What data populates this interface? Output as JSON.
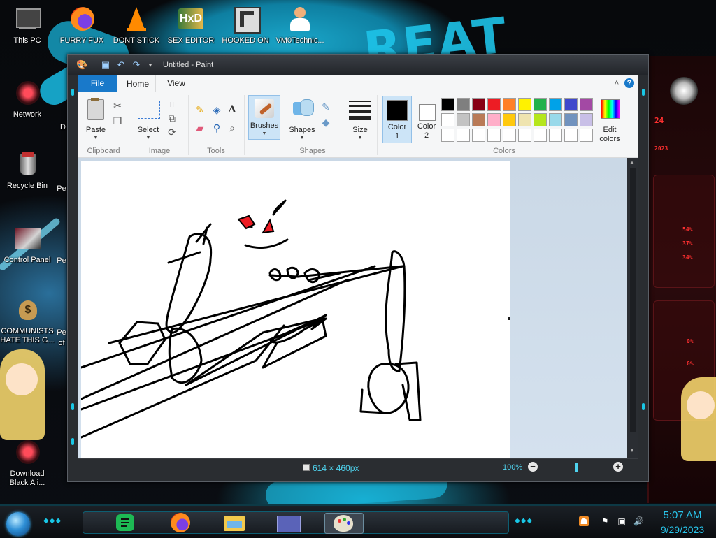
{
  "desktop": {
    "icons": [
      {
        "label": "This PC"
      },
      {
        "label": "FURRY FUX"
      },
      {
        "label": "DONT STICK"
      },
      {
        "label": "SEX EDITOR"
      },
      {
        "label": "HOOKED ON"
      },
      {
        "label": "VM0Technic..."
      },
      {
        "label": "Network"
      },
      {
        "label": "Recycle Bin"
      },
      {
        "label": "Control Panel"
      },
      {
        "label": "COMMUNISTS HATE THIS G..."
      },
      {
        "label": "Download Black Ali..."
      }
    ],
    "partial_labels": [
      "Pe",
      "Pe",
      "Pe",
      "Pe",
      "of",
      "D",
      "o"
    ]
  },
  "gadget": {
    "top_text": "24",
    "sub_text": "2023",
    "readouts": [
      "54%",
      "37%",
      "34%",
      "0%",
      "0%"
    ]
  },
  "paint": {
    "title": "Untitled - Paint",
    "tabs": {
      "file": "File",
      "home": "Home",
      "view": "View"
    },
    "groups": {
      "clipboard": "Clipboard",
      "image": "Image",
      "tools": "Tools",
      "shapes": "Shapes",
      "colors": "Colors"
    },
    "buttons": {
      "paste": "Paste",
      "select": "Select",
      "brushes": "Brushes",
      "shapes": "Shapes",
      "size": "Size",
      "color1": "Color",
      "color1_num": "1",
      "color2": "Color",
      "color2_num": "2",
      "edit_colors": "Edit",
      "edit_colors_2": "colors"
    },
    "text_tool": "A",
    "color1_value": "#000000",
    "color2_value": "#ffffff",
    "palette_row1": [
      "#000000",
      "#7f7f7f",
      "#880015",
      "#ed1c24",
      "#ff7f27",
      "#fff200",
      "#22b14c",
      "#00a2e8",
      "#3f48cc",
      "#a349a4"
    ],
    "palette_row2": [
      "#ffffff",
      "#c3c3c3",
      "#b97a57",
      "#ffaec9",
      "#ffc90e",
      "#efe4b0",
      "#b5e61d",
      "#99d9ea",
      "#7092be",
      "#c8bfe7"
    ],
    "palette_row3": [
      "#ffffff",
      "#ffffff",
      "#ffffff",
      "#ffffff",
      "#ffffff",
      "#ffffff",
      "#ffffff",
      "#ffffff",
      "#ffffff",
      "#ffffff"
    ],
    "status": {
      "dimensions": "614 × 460px",
      "zoom": "100%"
    }
  },
  "taskbar": {
    "time": "5:07 AM",
    "date": "9/29/2023",
    "apps": [
      "spotify-like-app",
      "firefox",
      "file-explorer",
      "window-app",
      "paint"
    ]
  }
}
